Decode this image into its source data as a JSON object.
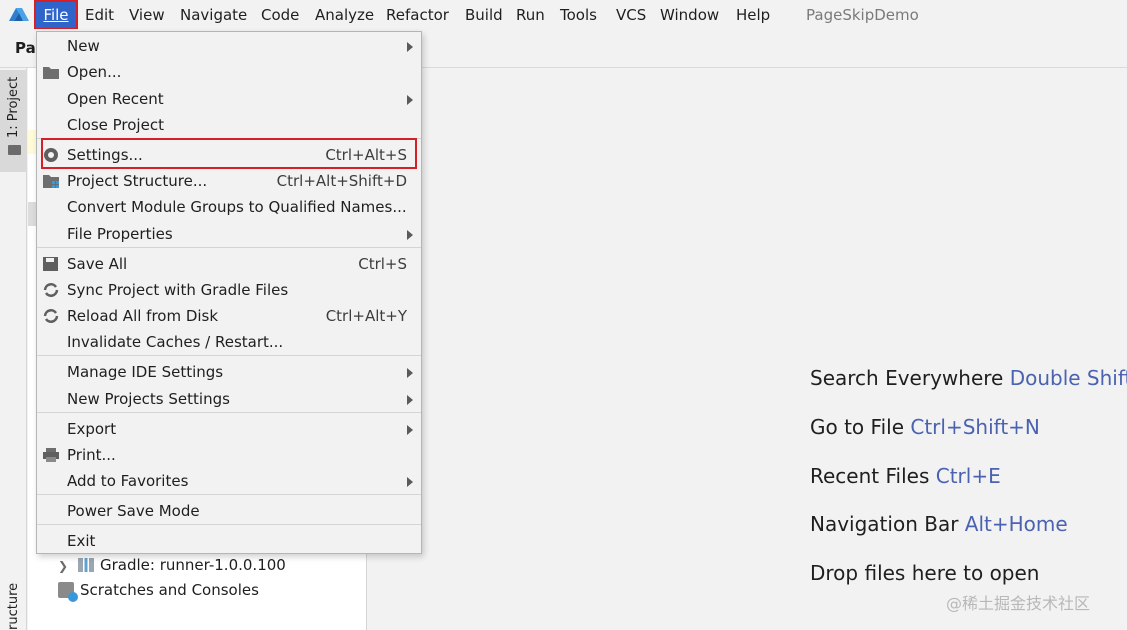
{
  "menubar": {
    "items": [
      "File",
      "Edit",
      "View",
      "Navigate",
      "Code",
      "Analyze",
      "Refactor",
      "Build",
      "Run",
      "Tools",
      "VCS",
      "Window",
      "Help"
    ],
    "project_title": "PageSkipDemo"
  },
  "navbar": {
    "crumb": "Pa"
  },
  "sidebar": {
    "project_label": "1: Project",
    "structure_label": "ructure"
  },
  "project_tree": {
    "rows": [
      {
        "label": "Gradle: runner-1.0.0.100",
        "icon": "gradle-library-icon"
      },
      {
        "label": "Scratches and Consoles",
        "icon": "scratches-icon"
      }
    ]
  },
  "file_menu": {
    "items": [
      {
        "label": "New",
        "shortcut": "",
        "submenu": true,
        "icon": ""
      },
      {
        "label": "Open...",
        "shortcut": "",
        "submenu": false,
        "icon": "folder-open-icon"
      },
      {
        "label": "Open Recent",
        "shortcut": "",
        "submenu": true,
        "icon": ""
      },
      {
        "label": "Close Project",
        "shortcut": "",
        "submenu": false,
        "icon": ""
      },
      {
        "label": "Settings...",
        "shortcut": "Ctrl+Alt+S",
        "submenu": false,
        "icon": "settings-gear-icon"
      },
      {
        "label": "Project Structure...",
        "shortcut": "Ctrl+Alt+Shift+D",
        "submenu": false,
        "icon": "project-structure-icon"
      },
      {
        "label": "Convert Module Groups to Qualified Names...",
        "shortcut": "",
        "submenu": false,
        "icon": ""
      },
      {
        "label": "File Properties",
        "shortcut": "",
        "submenu": true,
        "icon": ""
      },
      {
        "label": "Save All",
        "shortcut": "Ctrl+S",
        "submenu": false,
        "icon": "save-all-icon"
      },
      {
        "label": "Sync Project with Gradle Files",
        "shortcut": "",
        "submenu": false,
        "icon": "sync-icon"
      },
      {
        "label": "Reload All from Disk",
        "shortcut": "Ctrl+Alt+Y",
        "submenu": false,
        "icon": "reload-icon"
      },
      {
        "label": "Invalidate Caches / Restart...",
        "shortcut": "",
        "submenu": false,
        "icon": ""
      },
      {
        "label": "Manage IDE Settings",
        "shortcut": "",
        "submenu": true,
        "icon": ""
      },
      {
        "label": "New Projects Settings",
        "shortcut": "",
        "submenu": true,
        "icon": ""
      },
      {
        "label": "Export",
        "shortcut": "",
        "submenu": true,
        "icon": ""
      },
      {
        "label": "Print...",
        "shortcut": "",
        "submenu": false,
        "icon": "printer-icon"
      },
      {
        "label": "Add to Favorites",
        "shortcut": "",
        "submenu": true,
        "icon": ""
      },
      {
        "label": "Power Save Mode",
        "shortcut": "",
        "submenu": false,
        "icon": ""
      },
      {
        "label": "Exit",
        "shortcut": "",
        "submenu": false,
        "icon": ""
      }
    ]
  },
  "editor_hints": [
    {
      "text": "Search Everywhere",
      "key": "Double Shift"
    },
    {
      "text": "Go to File",
      "key": "Ctrl+Shift+N"
    },
    {
      "text": "Recent Files",
      "key": "Ctrl+E"
    },
    {
      "text": "Navigation Bar",
      "key": "Alt+Home"
    },
    {
      "text": "Drop files here to open",
      "key": ""
    }
  ],
  "watermark": "@稀土掘金技术社区",
  "colors": {
    "accent": "#2f65ca",
    "highlight_outline": "#d62028",
    "hint_key": "#4a62b0"
  }
}
